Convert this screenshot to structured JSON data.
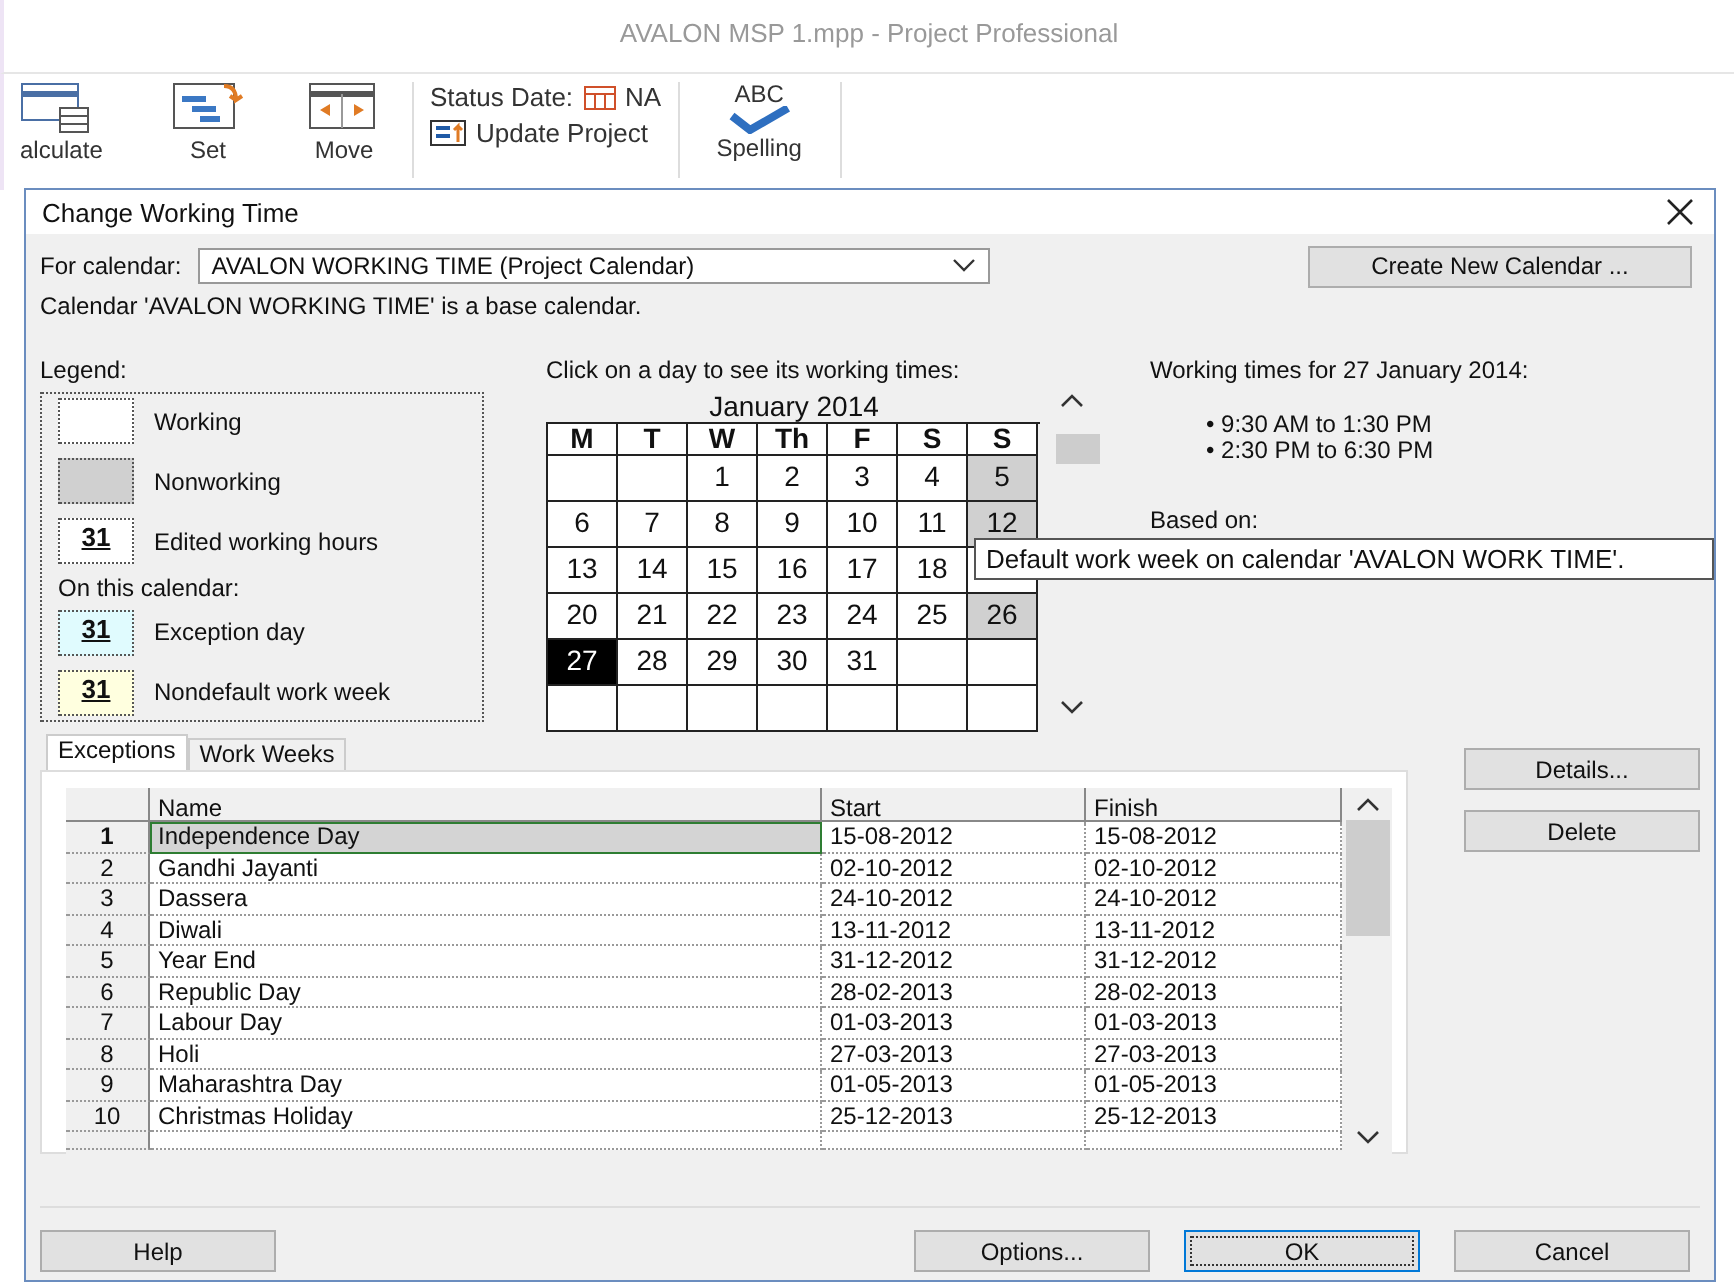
{
  "app_title": "AVALON MSP 1.mpp - Project Professional",
  "ribbon": {
    "commands": [
      {
        "kind": "calculate",
        "label": "alculate"
      },
      {
        "kind": "set",
        "label": "Set"
      },
      {
        "kind": "move",
        "label": "Move"
      }
    ],
    "status_date_label": "Status Date:",
    "status_date_value": "NA",
    "update_project": "Update Project",
    "spelling_mark": "ABC",
    "spelling": "Spelling"
  },
  "dialog": {
    "title": "Change Working Time",
    "for_calendar_label": "For calendar:",
    "calendar_value": "AVALON WORKING TIME (Project Calendar)",
    "create_button": "Create New Calendar ...",
    "base_note": "Calendar 'AVALON WORKING TIME' is a base calendar.",
    "legend_title": "Legend:",
    "legend": [
      {
        "kind": "working",
        "label": "Working"
      },
      {
        "kind": "nonworking",
        "label": "Nonworking"
      },
      {
        "kind": "edited",
        "mark": "31",
        "label": "Edited working hours"
      },
      {
        "kind": "heading",
        "label": "On this calendar:"
      },
      {
        "kind": "exception",
        "mark": "31",
        "label": "Exception day"
      },
      {
        "kind": "nondefault",
        "mark": "31",
        "label": "Nondefault work week"
      }
    ],
    "calendar_hint": "Click on a day to see its working times:",
    "month": "January 2014",
    "weekdays": [
      "M",
      "T",
      "W",
      "Th",
      "F",
      "S",
      "S"
    ],
    "weeks": [
      [
        {
          "kind": "blank"
        },
        {
          "kind": "blank"
        },
        {
          "kind": "day",
          "day": "1",
          "nonworking": false,
          "selected": false
        },
        {
          "kind": "day",
          "day": "2",
          "nonworking": false,
          "selected": false
        },
        {
          "kind": "day",
          "day": "3",
          "nonworking": false,
          "selected": false
        },
        {
          "kind": "day",
          "day": "4",
          "nonworking": false,
          "selected": false
        },
        {
          "kind": "day",
          "day": "5",
          "nonworking": true,
          "selected": false
        }
      ],
      [
        {
          "kind": "day",
          "day": "6",
          "nonworking": false,
          "selected": false
        },
        {
          "kind": "day",
          "day": "7",
          "nonworking": false,
          "selected": false
        },
        {
          "kind": "day",
          "day": "8",
          "nonworking": false,
          "selected": false
        },
        {
          "kind": "day",
          "day": "9",
          "nonworking": false,
          "selected": false
        },
        {
          "kind": "day",
          "day": "10",
          "nonworking": false,
          "selected": false
        },
        {
          "kind": "day",
          "day": "11",
          "nonworking": false,
          "selected": false
        },
        {
          "kind": "day",
          "day": "12",
          "nonworking": true,
          "selected": false
        }
      ],
      [
        {
          "kind": "day",
          "day": "13",
          "nonworking": false,
          "selected": false
        },
        {
          "kind": "day",
          "day": "14",
          "nonworking": false,
          "selected": false
        },
        {
          "kind": "day",
          "day": "15",
          "nonworking": false,
          "selected": false
        },
        {
          "kind": "day",
          "day": "16",
          "nonworking": false,
          "selected": false
        },
        {
          "kind": "day",
          "day": "17",
          "nonworking": false,
          "selected": false
        },
        {
          "kind": "day",
          "day": "18",
          "nonworking": false,
          "selected": false
        },
        {
          "kind": "blank"
        }
      ],
      [
        {
          "kind": "day",
          "day": "20",
          "nonworking": false,
          "selected": false
        },
        {
          "kind": "day",
          "day": "21",
          "nonworking": false,
          "selected": false
        },
        {
          "kind": "day",
          "day": "22",
          "nonworking": false,
          "selected": false
        },
        {
          "kind": "day",
          "day": "23",
          "nonworking": false,
          "selected": false
        },
        {
          "kind": "day",
          "day": "24",
          "nonworking": false,
          "selected": false
        },
        {
          "kind": "day",
          "day": "25",
          "nonworking": false,
          "selected": false
        },
        {
          "kind": "day",
          "day": "26",
          "nonworking": true,
          "selected": false
        }
      ],
      [
        {
          "kind": "day",
          "day": "27",
          "nonworking": false,
          "selected": true
        },
        {
          "kind": "day",
          "day": "28",
          "nonworking": false,
          "selected": false
        },
        {
          "kind": "day",
          "day": "29",
          "nonworking": false,
          "selected": false
        },
        {
          "kind": "day",
          "day": "30",
          "nonworking": false,
          "selected": false
        },
        {
          "kind": "day",
          "day": "31",
          "nonworking": false,
          "selected": false
        },
        {
          "kind": "blank"
        },
        {
          "kind": "blank"
        }
      ],
      [
        {
          "kind": "blank"
        },
        {
          "kind": "blank"
        },
        {
          "kind": "blank"
        },
        {
          "kind": "blank"
        },
        {
          "kind": "blank"
        },
        {
          "kind": "blank"
        },
        {
          "kind": "blank"
        }
      ]
    ],
    "times_title": "Working times for 27 January 2014:",
    "times": [
      "• 9:30 AM to 1:30 PM",
      "• 2:30 PM to 6:30 PM"
    ],
    "based_on": "Based on:",
    "tooltip": "Default work week on calendar 'AVALON WORK TIME'.",
    "tabs": [
      {
        "label": "Exceptions",
        "selected": true
      },
      {
        "label": "Work Weeks",
        "selected": false
      }
    ],
    "columns": [
      "Name",
      "Start",
      "Finish"
    ],
    "rows": [
      {
        "num": "1",
        "name": "Independence Day",
        "start": "15-08-2012",
        "finish": "15-08-2012",
        "selected": true
      },
      {
        "num": "2",
        "name": "Gandhi Jayanti",
        "start": "02-10-2012",
        "finish": "02-10-2012",
        "selected": false
      },
      {
        "num": "3",
        "name": "Dassera",
        "start": "24-10-2012",
        "finish": "24-10-2012",
        "selected": false
      },
      {
        "num": "4",
        "name": "Diwali",
        "start": "13-11-2012",
        "finish": "13-11-2012",
        "selected": false
      },
      {
        "num": "5",
        "name": "Year End",
        "start": "31-12-2012",
        "finish": "31-12-2012",
        "selected": false
      },
      {
        "num": "6",
        "name": "Republic Day",
        "start": "28-02-2013",
        "finish": "28-02-2013",
        "selected": false
      },
      {
        "num": "7",
        "name": "Labour Day",
        "start": "01-03-2013",
        "finish": "01-03-2013",
        "selected": false
      },
      {
        "num": "8",
        "name": "Holi",
        "start": "27-03-2013",
        "finish": "27-03-2013",
        "selected": false
      },
      {
        "num": "9",
        "name": "Maharashtra Day",
        "start": "01-05-2013",
        "finish": "01-05-2013",
        "selected": false
      },
      {
        "num": "10",
        "name": "Christmas Holiday",
        "start": "25-12-2013",
        "finish": "25-12-2013",
        "selected": false
      }
    ],
    "side_buttons": [
      "Details...",
      "Delete"
    ],
    "help_button": "Help",
    "footer_buttons": [
      {
        "label": "Options...",
        "default": false
      },
      {
        "label": "OK",
        "default": true
      },
      {
        "label": "Cancel",
        "default": false
      }
    ]
  }
}
